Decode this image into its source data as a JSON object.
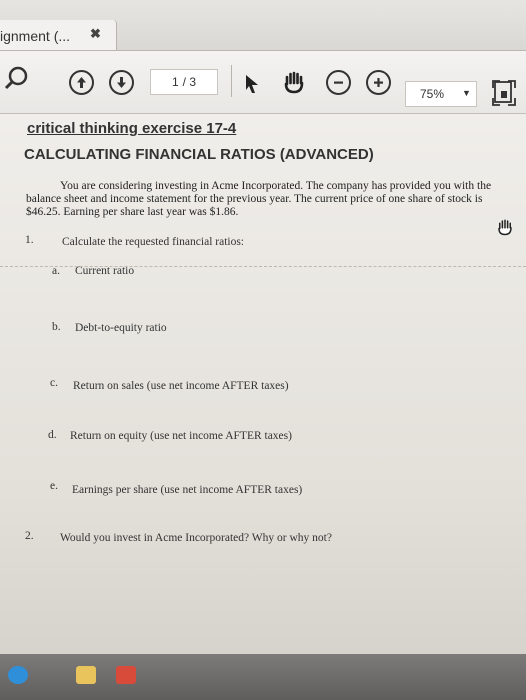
{
  "tab": {
    "title": "ignment (...",
    "close_glyph": "✖"
  },
  "toolbar": {
    "icons": [
      "search-icon",
      "page-up-icon",
      "page-down-icon",
      "select-arrow-icon",
      "hand-tool-icon",
      "zoom-out-icon",
      "zoom-in-icon",
      "fit-page-icon"
    ],
    "page_current": "1",
    "page_total": "/ 3",
    "zoom": "75%"
  },
  "document": {
    "title": "critical thinking exercise 17-4",
    "subtitle": "CALCULATING FINANCIAL RATIOS (ADVANCED)",
    "intro_line1": "You are considering investing in Acme Incorporated. The company has provided you with the",
    "intro_rest": "balance sheet and income statement for the previous year. The current price of one share of stock is $46.25. Earning per share last year was $1.86.",
    "q1_num": "1.",
    "q1_text": "Calculate the requested financial ratios:",
    "items": [
      {
        "letter": "a.",
        "text": "Current ratio"
      },
      {
        "letter": "b.",
        "text": "Debt-to-equity ratio"
      },
      {
        "letter": "c.",
        "text": "Return on sales (use net income AFTER taxes)"
      },
      {
        "letter": "d.",
        "text": "Return on equity (use net income AFTER taxes)"
      },
      {
        "letter": "e.",
        "text": "Earnings per share (use net income AFTER taxes)"
      }
    ],
    "q2_num": "2.",
    "q2_text": "Would you invest in Acme Incorporated? Why or why not?"
  },
  "taskbar": {
    "icons": [
      "edge-icon",
      "folder-icon",
      "acrobat-icon"
    ],
    "colors": {
      "edge": "#2f8fd8",
      "folder": "#e9c35b",
      "acrobat": "#d84a3a"
    }
  }
}
